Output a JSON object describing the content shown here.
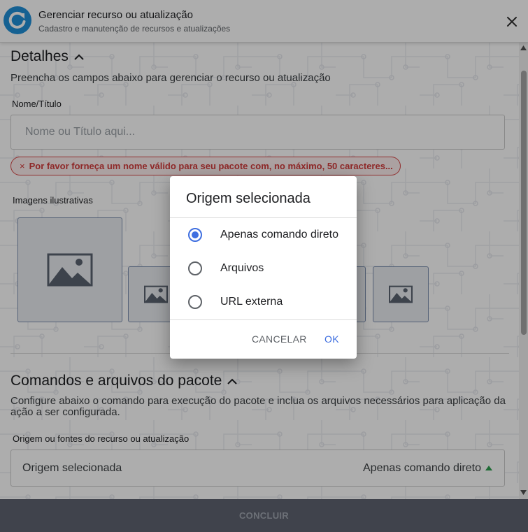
{
  "header": {
    "title": "Gerenciar recurso ou atualização",
    "subtitle": "Cadastro e manutenção de recursos e atualizações",
    "logo_icon": "refresh-icon",
    "close_icon": "close-icon"
  },
  "details": {
    "title": "Detalhes",
    "description": "Preencha os campos abaixo para gerenciar o recurso ou atualização",
    "name_label": "Nome/Título",
    "name_value": "",
    "name_placeholder": "Nome ou Título aqui...",
    "error_message": "Por favor forneça um nome válido para seu pacote com, no máximo, 50 caracteres...",
    "images_label": "Imagens ilustrativas",
    "image_icon": "image-placeholder-icon"
  },
  "commands": {
    "title": "Comandos e arquivos do pacote",
    "description": "Configure abaixo o comando para execução do pacote e inclua os arquivos necessários para aplicação da ação a ser configurada.",
    "origin_label": "Origem ou fontes do recurso ou atualização",
    "select_label": "Origem selecionada",
    "select_value": "Apenas comando direto"
  },
  "footer": {
    "conclude_label": "CONCLUIR"
  },
  "dialog": {
    "title": "Origem selecionada",
    "options": [
      {
        "label": "Apenas comando direto",
        "selected": true
      },
      {
        "label": "Arquivos",
        "selected": false
      },
      {
        "label": "URL externa",
        "selected": false
      }
    ],
    "cancel_label": "CANCELAR",
    "ok_label": "OK"
  },
  "colors": {
    "accent": "#3f6fe0",
    "error": "#d23b3b",
    "success_caret": "#2e9e4f",
    "footer_bg": "#5f6470",
    "logo": "#1f8fd8"
  }
}
